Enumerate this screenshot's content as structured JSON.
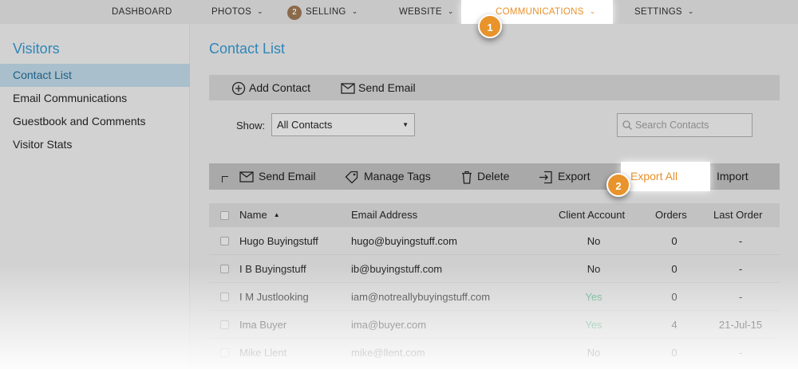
{
  "nav": {
    "dashboard": "DASHBOARD",
    "photos": "PHOTOS",
    "selling_count": "2",
    "selling": "SELLING",
    "website": "WEBSITE",
    "communications": "COMMUNICATIONS",
    "settings": "SETTINGS",
    "active_color": "#e8902a"
  },
  "steps": {
    "one": "1",
    "two": "2"
  },
  "sidebar": {
    "title": "Visitors",
    "items": [
      {
        "label": "Contact List"
      },
      {
        "label": "Email Communications"
      },
      {
        "label": "Guestbook and Comments"
      },
      {
        "label": "Visitor Stats"
      }
    ]
  },
  "main": {
    "title": "Contact List",
    "toolbar": {
      "add_contact": "Add Contact",
      "send_email": "Send Email"
    },
    "filter": {
      "label": "Show:",
      "selected": "All Contacts"
    },
    "search": {
      "placeholder": "Search Contacts"
    },
    "actions": {
      "send_email": "Send Email",
      "manage_tags": "Manage Tags",
      "delete": "Delete",
      "export": "Export",
      "export_all": "Export All",
      "import": "Import"
    }
  },
  "table": {
    "headers": {
      "name": "Name",
      "email": "Email Address",
      "client": "Client Account",
      "orders": "Orders",
      "last_order": "Last Order"
    },
    "rows": [
      {
        "name": "Hugo Buyingstuff",
        "email": "hugo@buyingstuff.com",
        "client": "No",
        "orders": "0",
        "last": "-"
      },
      {
        "name": "I B Buyingstuff",
        "email": "ib@buyingstuff.com",
        "client": "No",
        "orders": "0",
        "last": "-"
      },
      {
        "name": "I M Justlooking",
        "email": "iam@notreallybuyingstuff.com",
        "client": "Yes",
        "orders": "0",
        "last": "-"
      },
      {
        "name": "Ima Buyer",
        "email": "ima@buyer.com",
        "client": "Yes",
        "orders": "4",
        "last": "21-Jul-15"
      },
      {
        "name": "Mike Llent",
        "email": "mike@llent.com",
        "client": "No",
        "orders": "0",
        "last": "-"
      }
    ]
  }
}
